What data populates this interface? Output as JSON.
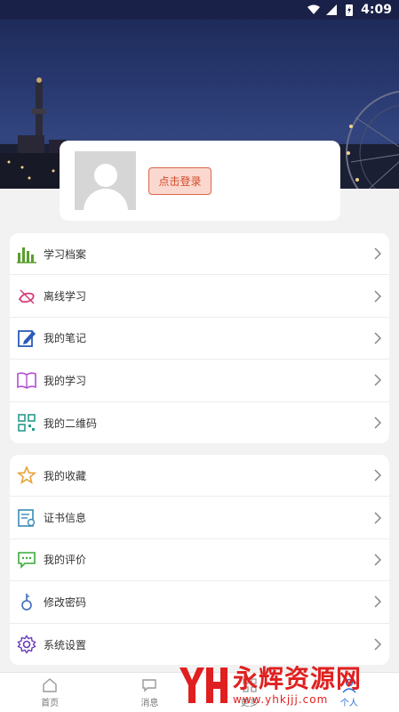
{
  "status_bar": {
    "time": "4:09"
  },
  "profile": {
    "login_label": "点击登录"
  },
  "menu_group_1": [
    {
      "label": "学习档案",
      "icon": "bar-chart-icon",
      "color": "#5a9e2f"
    },
    {
      "label": "离线学习",
      "icon": "offline-icon",
      "color": "#d83a7a"
    },
    {
      "label": "我的笔记",
      "icon": "note-icon",
      "color": "#2a5bb8"
    },
    {
      "label": "我的学习",
      "icon": "book-icon",
      "color": "#b04fd0"
    },
    {
      "label": "我的二维码",
      "icon": "qrcode-icon",
      "color": "#2a9a8a"
    }
  ],
  "menu_group_2": [
    {
      "label": "我的收藏",
      "icon": "star-icon",
      "color": "#e8a23a"
    },
    {
      "label": "证书信息",
      "icon": "certificate-icon",
      "color": "#3a8ab8"
    },
    {
      "label": "我的评价",
      "icon": "comment-icon",
      "color": "#3aa83a"
    },
    {
      "label": "修改密码",
      "icon": "key-icon",
      "color": "#3a6ab8"
    },
    {
      "label": "系统设置",
      "icon": "gear-icon",
      "color": "#6a3ab8"
    }
  ],
  "bottom_nav": [
    {
      "label": "首页",
      "icon": "home-icon"
    },
    {
      "label": "消息",
      "icon": "message-icon"
    },
    {
      "label": "更多",
      "icon": "more-icon"
    },
    {
      "label": "个人",
      "icon": "person-icon"
    }
  ],
  "watermark": {
    "title": "永辉资源网",
    "url": "www.yhkjjj.com"
  }
}
